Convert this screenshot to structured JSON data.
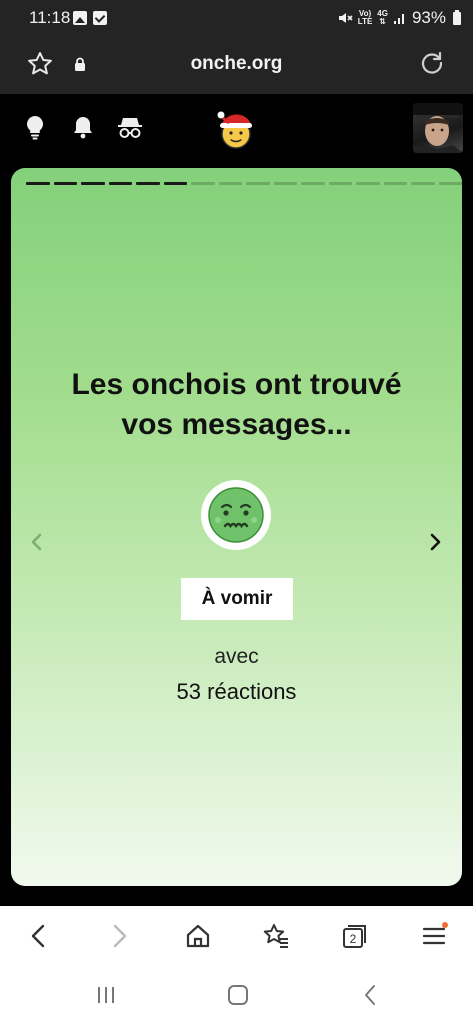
{
  "status_bar": {
    "time": "11:18",
    "battery": "93%",
    "network_top": "Vo)",
    "network_bottom": "LTE",
    "gen": "4G"
  },
  "browser": {
    "url": "onche.org",
    "tab_count": "2"
  },
  "card": {
    "headline_line1": "Les onchois ont trouvé",
    "headline_line2": "vos messages...",
    "reaction_label": "À vomir",
    "avec": "avec",
    "count_number": "53",
    "count_suffix": "réactions",
    "progress_done": 6,
    "progress_total": 16,
    "background_color": "#a0dc8c"
  },
  "icons": {
    "header": [
      "lightbulb-icon",
      "bell-icon",
      "incognito-icon"
    ],
    "logo": "onche-santa-logo",
    "reaction_emoji": "nauseated-face-icon"
  }
}
